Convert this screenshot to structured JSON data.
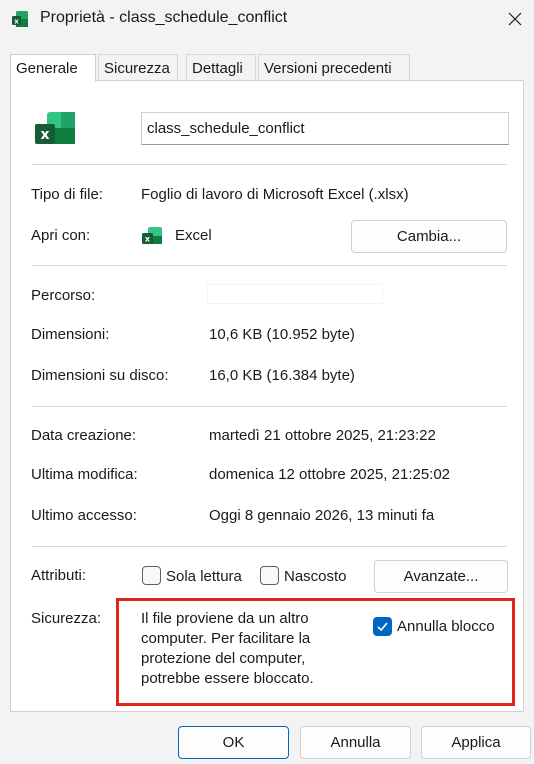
{
  "window": {
    "title": "Proprietà - class_schedule_conflict"
  },
  "tabs": [
    {
      "label": "Generale",
      "active": true
    },
    {
      "label": "Sicurezza",
      "active": false
    },
    {
      "label": "Dettagli",
      "active": false
    },
    {
      "label": "Versioni precedenti",
      "active": false
    }
  ],
  "file": {
    "name": "class_schedule_conflict",
    "icon": "excel-icon"
  },
  "info": {
    "type_label": "Tipo di file:",
    "type_value": "Foglio di lavoro di Microsoft Excel (.xlsx)",
    "open_with_label": "Apri con:",
    "open_with_value": "Excel",
    "change_button": "Cambia...",
    "location_label": "Percorso:",
    "size_label": "Dimensioni:",
    "size_value": "10,6 KB (10.952 byte)",
    "size_on_disk_label": "Dimensioni su disco:",
    "size_on_disk_value": "16,0 KB (16.384 byte)",
    "created_label": "Data creazione:",
    "created_value": "martedì 21 ottobre 2025, 21:23:22",
    "modified_label": "Ultima modifica:",
    "modified_value": "domenica 12 ottobre 2025, 21:25:02",
    "accessed_label": "Ultimo accesso:",
    "accessed_value": "Oggi 8 gennaio 2026, 13 minuti fa"
  },
  "attributes": {
    "label": "Attributi:",
    "readonly_label": "Sola lettura",
    "readonly_checked": false,
    "hidden_label": "Nascosto",
    "hidden_checked": false,
    "advanced_button": "Avanzate..."
  },
  "security": {
    "label": "Sicurezza:",
    "message": "Il file proviene da un altro computer. Per facilitare la protezione del computer, potrebbe essere bloccato.",
    "unblock_label": "Annulla blocco",
    "unblock_checked": true,
    "highlight_color": "#e2231a"
  },
  "footer": {
    "ok": "OK",
    "cancel": "Annulla",
    "apply": "Applica"
  },
  "colors": {
    "accent": "#0067c0",
    "excel_green": "#107c41"
  }
}
